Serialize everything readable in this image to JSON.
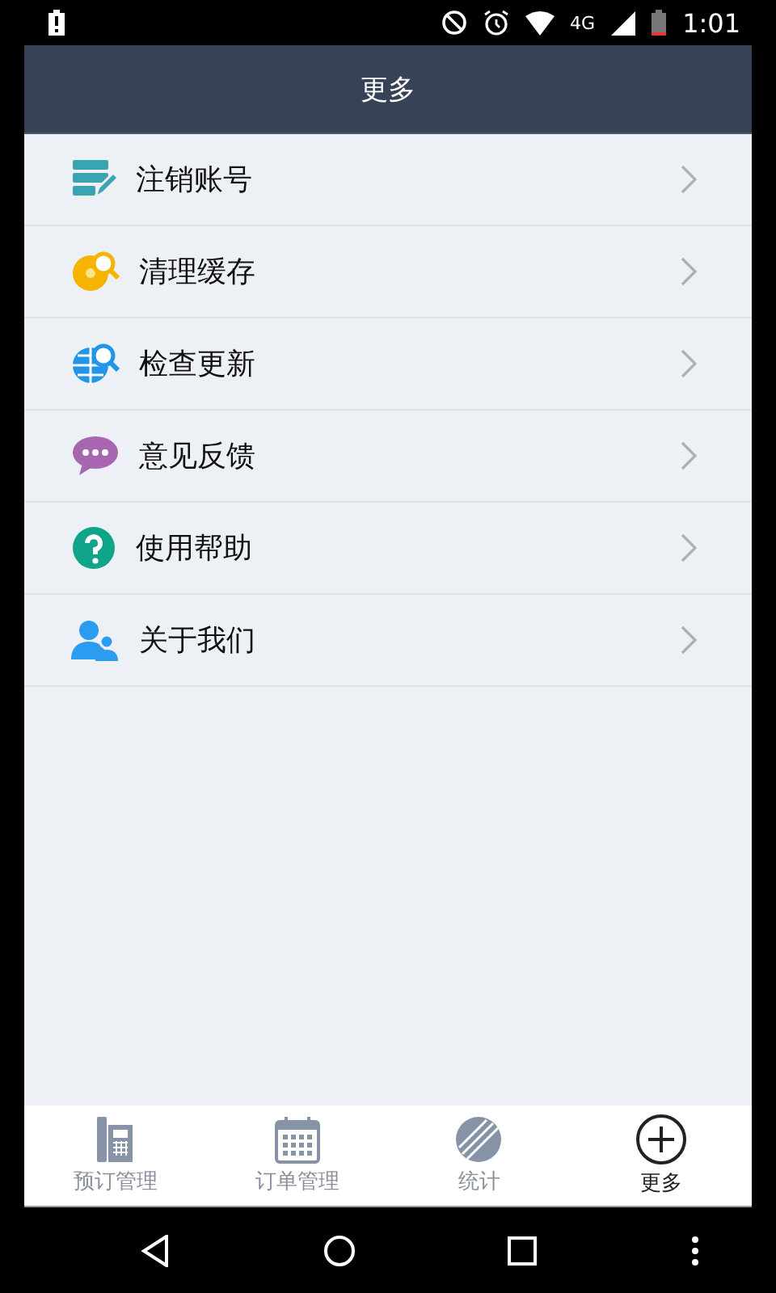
{
  "status_bar": {
    "time": "1:01",
    "network": "4G"
  },
  "header": {
    "title": "更多"
  },
  "menu": [
    {
      "label": "注销账号",
      "kind": "logout"
    },
    {
      "label": "清理缓存",
      "kind": "cache"
    },
    {
      "label": "检查更新",
      "kind": "update"
    },
    {
      "label": "意见反馈",
      "kind": "feedback"
    },
    {
      "label": "使用帮助",
      "kind": "help"
    },
    {
      "label": "关于我们",
      "kind": "about"
    }
  ],
  "tabs": [
    {
      "label": "预订管理",
      "kind": "phone",
      "selected": false
    },
    {
      "label": "订单管理",
      "kind": "calendar",
      "selected": false
    },
    {
      "label": "统计",
      "kind": "stats",
      "selected": false
    },
    {
      "label": "更多",
      "kind": "more",
      "selected": true
    }
  ]
}
